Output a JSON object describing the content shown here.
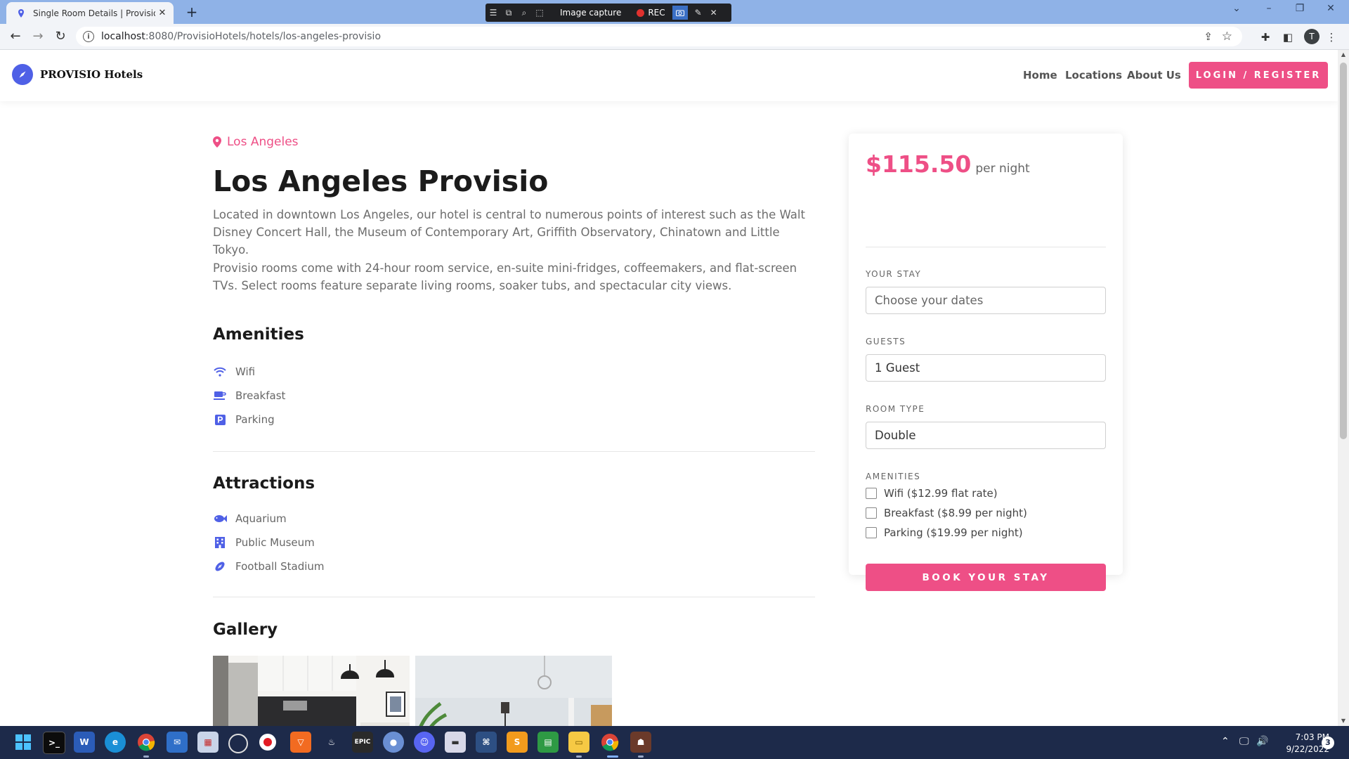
{
  "browser": {
    "tab_title": "Single Room Details | Provisio Ho",
    "url_host": "localhost",
    "url_path": ":8080/ProvisioHotels/hotels/los-angeles-provisio",
    "profile_initial": "T"
  },
  "capture_toolbar": {
    "label": "Image capture",
    "rec_label": "REC"
  },
  "site": {
    "brand": "PROVISIO Hotels",
    "nav": [
      "Home",
      "Locations",
      "About Us"
    ],
    "login_label": "LOGIN / REGISTER"
  },
  "hotel": {
    "location": "Los Angeles",
    "name": "Los Angeles Provisio",
    "description_1": "Located in downtown Los Angeles, our hotel is central to numerous points of interest such as the Walt Disney Concert Hall, the Museum of Contemporary Art, Griffith Observatory, Chinatown and Little Tokyo.",
    "description_2": "Provisio rooms come with 24-hour room service, en-suite mini-fridges, coffeemakers, and flat-screen TVs. Select rooms feature separate living rooms, soaker tubs, and spectacular city views.",
    "amenities_heading": "Amenities",
    "amenities": [
      {
        "label": "Wifi",
        "icon": "wifi-icon"
      },
      {
        "label": "Breakfast",
        "icon": "coffee-cup-icon"
      },
      {
        "label": "Parking",
        "icon": "parking-icon"
      }
    ],
    "attractions_heading": "Attractions",
    "attractions": [
      {
        "label": "Aquarium",
        "icon": "fish-icon"
      },
      {
        "label": "Public Museum",
        "icon": "building-icon"
      },
      {
        "label": "Football Stadium",
        "icon": "football-icon"
      }
    ],
    "gallery_heading": "Gallery"
  },
  "booking": {
    "price": "$115.50",
    "per_night": "per night",
    "stay_label": "YOUR STAY",
    "stay_placeholder": "Choose your dates",
    "guests_label": "GUESTS",
    "guests_value": "1 Guest",
    "room_label": "ROOM TYPE",
    "room_value": "Double",
    "amenities_label": "AMENITIES",
    "amenity_options": [
      {
        "label": "Wifi ($12.99 flat rate)",
        "checked": false
      },
      {
        "label": "Breakfast ($8.99 per night)",
        "checked": false
      },
      {
        "label": "Parking ($19.99 per night)",
        "checked": false
      }
    ],
    "book_label": "BOOK YOUR STAY"
  },
  "taskbar": {
    "time": "7:03 PM",
    "date": "9/22/2022",
    "notifications": "3"
  },
  "colors": {
    "accent_pink": "#ee4f86",
    "brand_blue": "#4f60e6"
  }
}
